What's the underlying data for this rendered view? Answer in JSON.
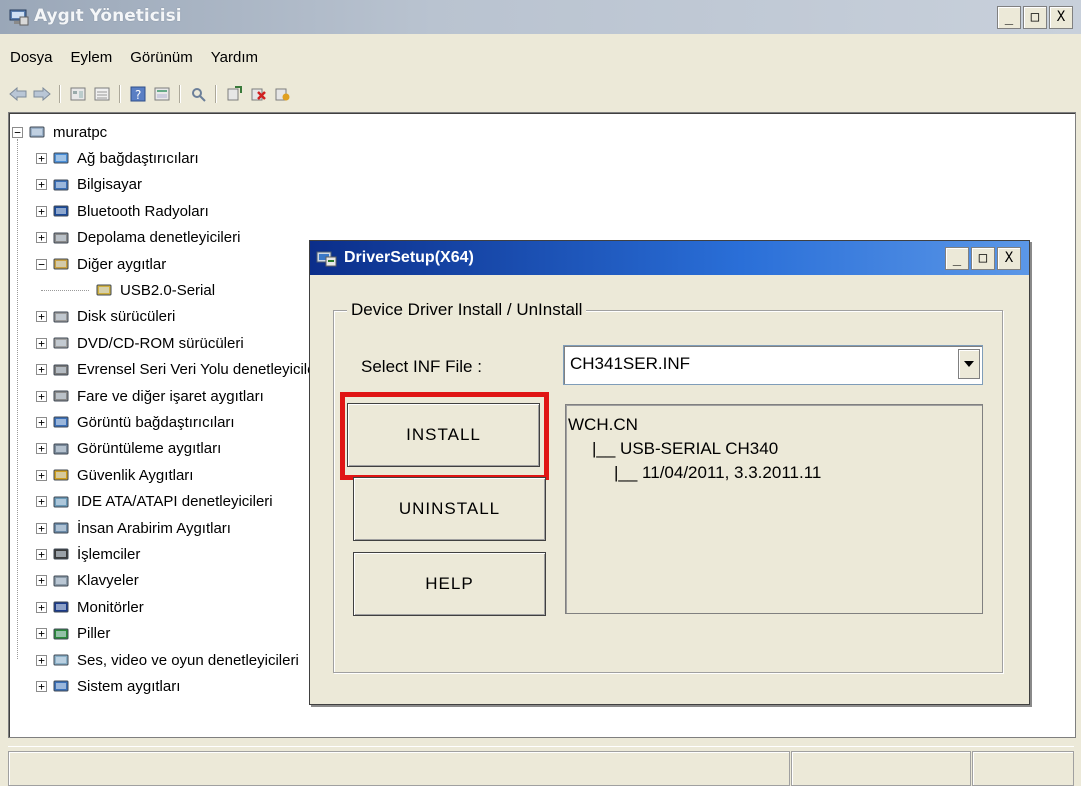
{
  "window": {
    "title": "Aygıt Yöneticisi",
    "controls": [
      "_",
      "□",
      "X"
    ]
  },
  "menu": [
    "Dosya",
    "Eylem",
    "Görünüm",
    "Yardım"
  ],
  "toolbar_icons": [
    "back-icon",
    "forward-icon",
    "properties-view-icon",
    "list-view-icon",
    "help-icon",
    "details-icon",
    "scan-hardware-icon",
    "update-driver-icon",
    "uninstall-icon",
    "disable-icon"
  ],
  "tree": {
    "root": "muratpc",
    "items": [
      {
        "label": "Ağ bağdaştırıcıları",
        "icon": "network-adapter-icon",
        "expander": "+"
      },
      {
        "label": "Bilgisayar",
        "icon": "computer-icon",
        "expander": "+"
      },
      {
        "label": "Bluetooth Radyoları",
        "icon": "bluetooth-icon",
        "expander": "+"
      },
      {
        "label": "Depolama denetleyicileri",
        "icon": "storage-controller-icon",
        "expander": "+"
      },
      {
        "label": "Diğer aygıtlar",
        "icon": "other-devices-icon",
        "expander": "-"
      },
      {
        "label": "Disk sürücüleri",
        "icon": "disk-drive-icon",
        "expander": "+"
      },
      {
        "label": "DVD/CD-ROM sürücüleri",
        "icon": "dvd-drive-icon",
        "expander": "+"
      },
      {
        "label": "Evrensel Seri Veri Yolu denetleyicileri",
        "icon": "usb-controller-icon",
        "expander": "+"
      },
      {
        "label": "Fare ve diğer işaret aygıtları",
        "icon": "mouse-icon",
        "expander": "+"
      },
      {
        "label": "Görüntü bağdaştırıcıları",
        "icon": "display-adapter-icon",
        "expander": "+"
      },
      {
        "label": "Görüntüleme aygıtları",
        "icon": "imaging-device-icon",
        "expander": "+"
      },
      {
        "label": "Güvenlik Aygıtları",
        "icon": "security-device-icon",
        "expander": "+"
      },
      {
        "label": "IDE ATA/ATAPI denetleyicileri",
        "icon": "ide-controller-icon",
        "expander": "+"
      },
      {
        "label": "İnsan Arabirim Aygıtları",
        "icon": "hid-icon",
        "expander": "+"
      },
      {
        "label": "İşlemciler",
        "icon": "processor-icon",
        "expander": "+"
      },
      {
        "label": "Klavyeler",
        "icon": "keyboard-icon",
        "expander": "+"
      },
      {
        "label": "Monitörler",
        "icon": "monitor-icon",
        "expander": "+"
      },
      {
        "label": "Piller",
        "icon": "battery-icon",
        "expander": "+"
      },
      {
        "label": "Ses, video ve oyun denetleyicileri",
        "icon": "sound-icon",
        "expander": "+"
      },
      {
        "label": "Sistem aygıtları",
        "icon": "system-device-icon",
        "expander": "+"
      }
    ],
    "child": {
      "label": "USB2.0-Serial",
      "icon": "unknown-device-icon"
    }
  },
  "dialog": {
    "title": "DriverSetup(X64)",
    "controls": [
      "_",
      "□",
      "X"
    ],
    "group_label": "Device Driver Install / UnInstall",
    "select_label": "Select INF File :",
    "select_value": "CH341SER.INF",
    "buttons": {
      "install": "INSTALL",
      "uninstall": "UNINSTALL",
      "help": "HELP"
    },
    "info": [
      "WCH.CN",
      "|__ USB-SERIAL CH340",
      "|__ 11/04/2011, 3.3.2011.11"
    ]
  },
  "colors": {
    "highlight": "#e01515",
    "dialog_title_start": "#0b2e8a",
    "dialog_title_end": "#5b97e7"
  }
}
